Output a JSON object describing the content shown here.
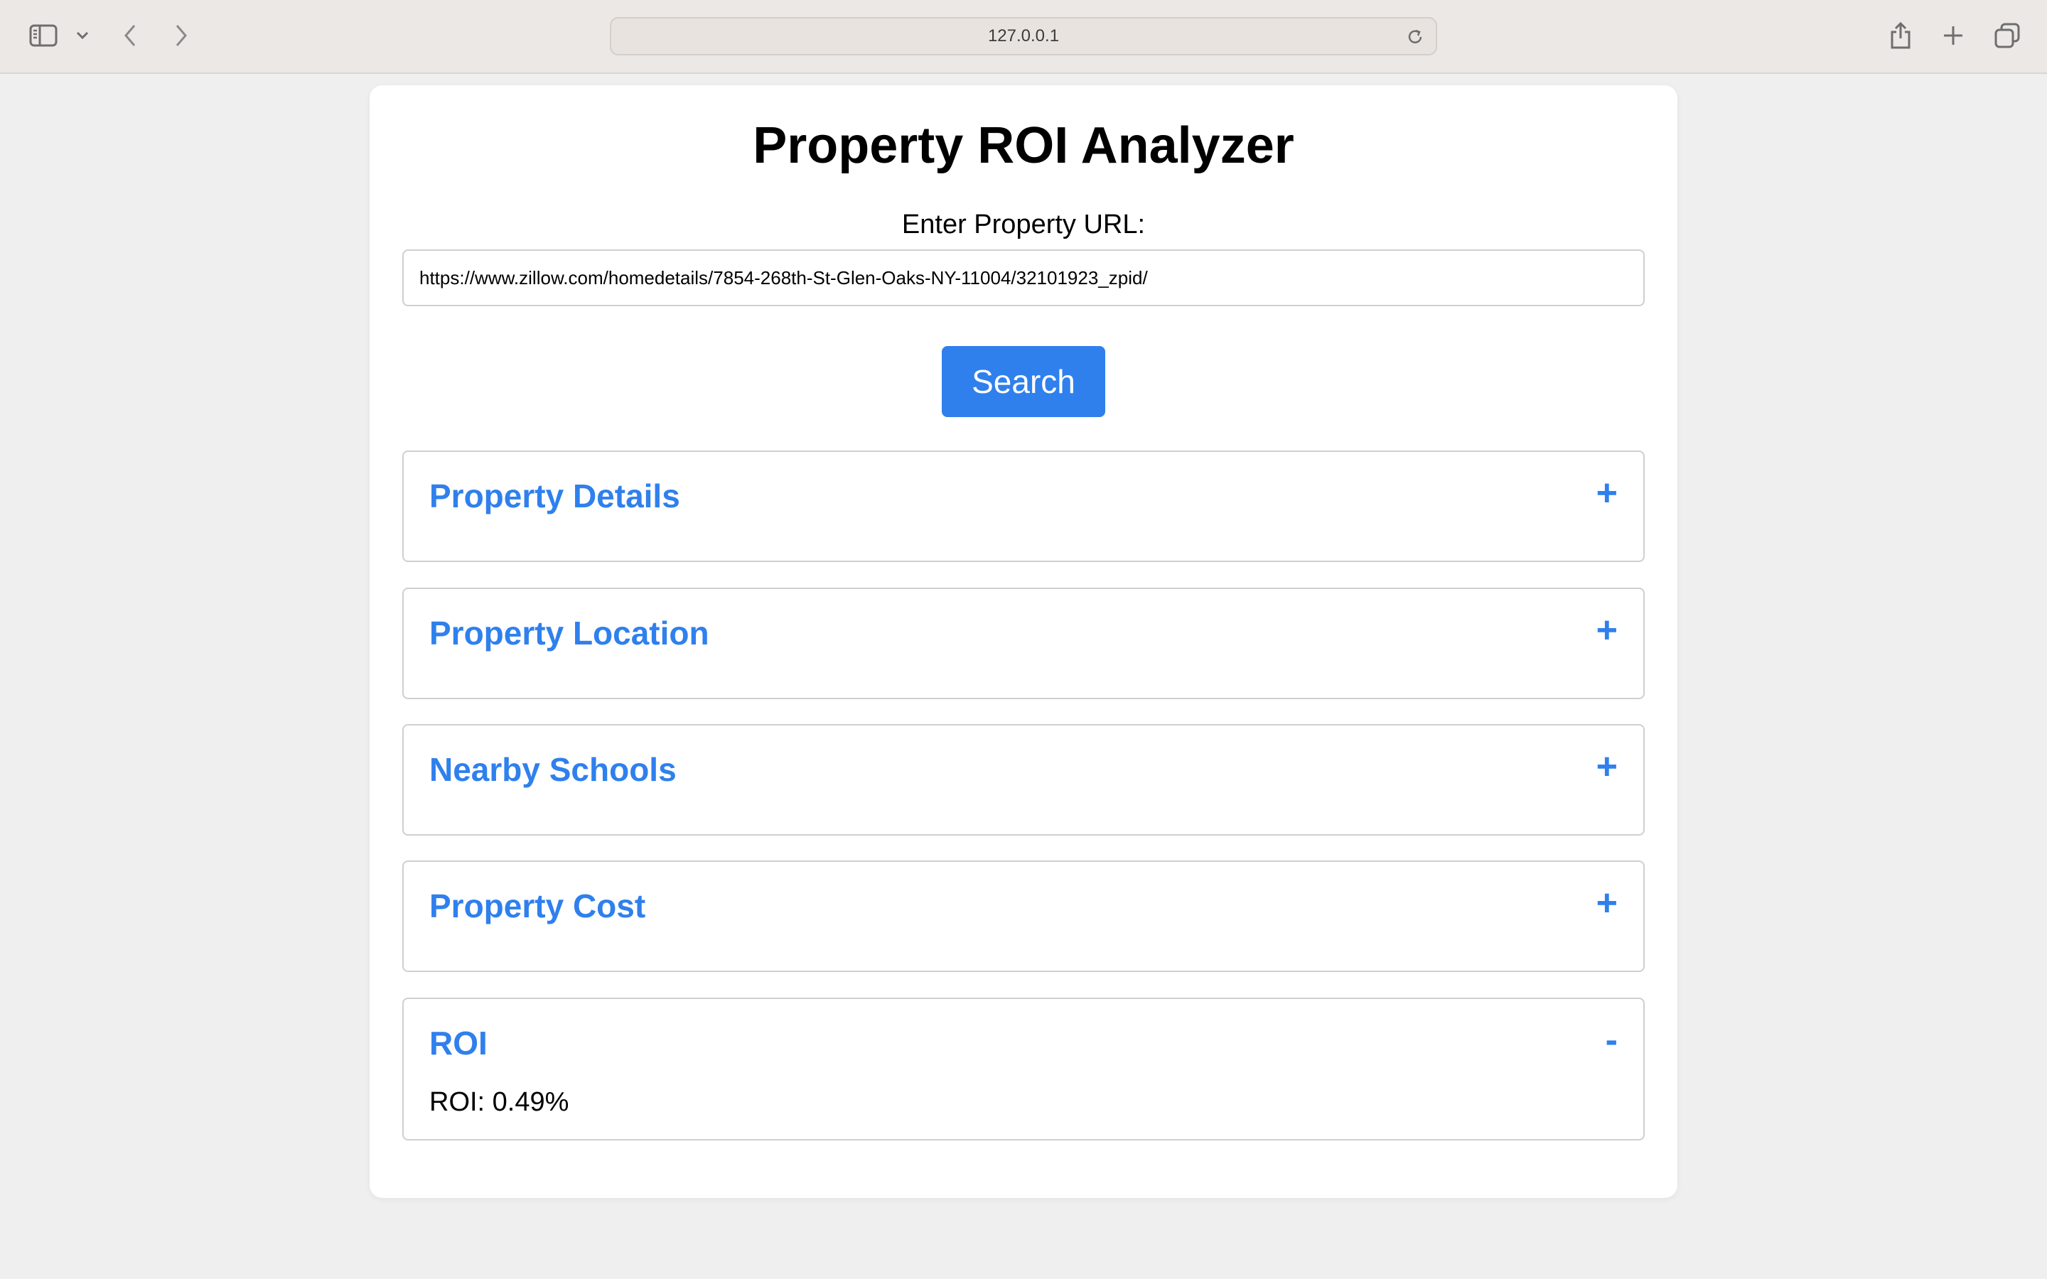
{
  "browser": {
    "url": "127.0.0.1",
    "icons": {
      "sidebar": "sidebar-icon",
      "chevron": "chevron-down-icon",
      "back": "back-icon",
      "forward": "forward-icon",
      "reload": "reload-icon",
      "share": "share-icon",
      "new_tab": "plus-icon",
      "tabs": "tabs-overview-icon"
    }
  },
  "page": {
    "title": "Property ROI Analyzer",
    "url_label": "Enter Property URL:",
    "url_value": "https://www.zillow.com/homedetails/7854-268th-St-Glen-Oaks-NY-11004/32101923_zpid/",
    "search_label": "Search"
  },
  "sections": [
    {
      "title": "Property Details",
      "toggle": "+",
      "expanded": false
    },
    {
      "title": "Property Location",
      "toggle": "+",
      "expanded": false
    },
    {
      "title": "Nearby Schools",
      "toggle": "+",
      "expanded": false
    },
    {
      "title": "Property Cost",
      "toggle": "+",
      "expanded": false
    },
    {
      "title": "ROI",
      "toggle": "-",
      "expanded": true,
      "content": "ROI: 0.49%"
    }
  ],
  "colors": {
    "accent": "#2f80ed",
    "toolbar": "#ece8e5",
    "background": "#efefef"
  }
}
